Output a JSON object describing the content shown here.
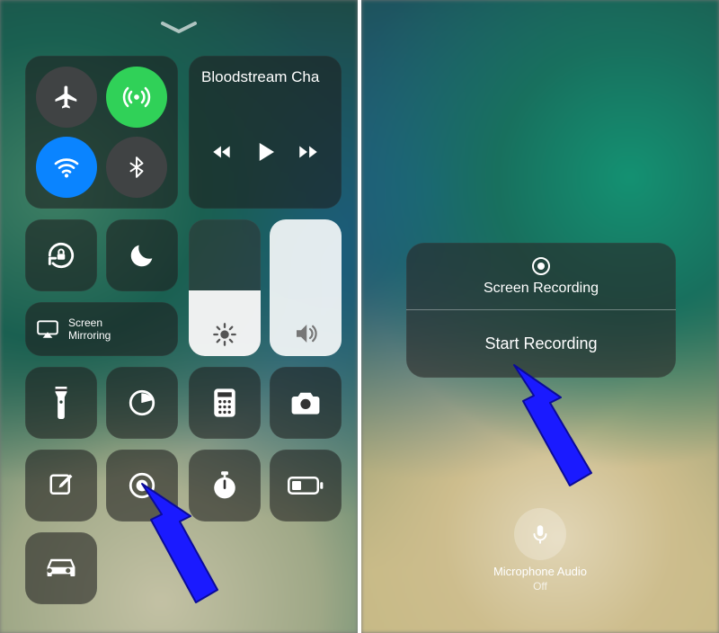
{
  "left": {
    "media_title": "Bloodstream Cha",
    "mirroring_label": "Screen\nMirroring",
    "brightness_pct": 48,
    "volume_pct": 100
  },
  "right": {
    "card_title": "Screen Recording",
    "card_action": "Start Recording",
    "mic_label": "Microphone Audio",
    "mic_state": "Off"
  },
  "colors": {
    "arrow": "#1a1aff",
    "cellular_on": "#30d158",
    "wifi_on": "#0a84ff"
  }
}
